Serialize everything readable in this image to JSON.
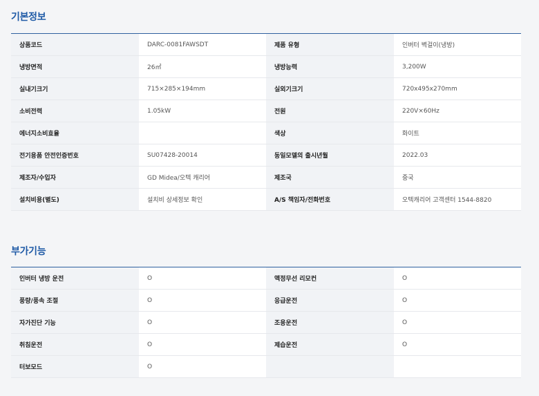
{
  "basic": {
    "title": "기본정보",
    "rows": [
      [
        {
          "k": "상품코드",
          "v": "DARC-0081FAWSDT"
        },
        {
          "k": "제품 유형",
          "v": "인버터 벽걸이(냉방)"
        }
      ],
      [
        {
          "k": "냉방면적",
          "v": "26㎡"
        },
        {
          "k": "냉방능력",
          "v": "3,200W"
        }
      ],
      [
        {
          "k": "실내기크기",
          "v": "715×285×194mm"
        },
        {
          "k": "실외기크기",
          "v": "720x495x270mm"
        }
      ],
      [
        {
          "k": "소비전력",
          "v": "1.05kW"
        },
        {
          "k": "전원",
          "v": "220V×60Hz"
        }
      ],
      [
        {
          "k": "에너지소비효율",
          "v": ""
        },
        {
          "k": "색상",
          "v": "화이트"
        }
      ],
      [
        {
          "k": "전기용품 안전인증번호",
          "v": "SU07428-20014"
        },
        {
          "k": "동일모델의 출시년월",
          "v": "2022.03"
        }
      ],
      [
        {
          "k": "제조자/수입자",
          "v": "GD Midea/오텍 캐리어"
        },
        {
          "k": "제조국",
          "v": "중국"
        }
      ],
      [
        {
          "k": "설치비용(별도)",
          "v": "설치비 상세정보 확인"
        },
        {
          "k": "A/S 책임자/전화번호",
          "v": "오텍캐리어 고객센터 1544-8820"
        }
      ]
    ]
  },
  "extra": {
    "title": "부가기능",
    "rows": [
      [
        {
          "k": "인버터 냉방 운전",
          "v": "O"
        },
        {
          "k": "액정무선 리모컨",
          "v": "O"
        }
      ],
      [
        {
          "k": "풍량/풍속 조절",
          "v": "O"
        },
        {
          "k": "응급운전",
          "v": "O"
        }
      ],
      [
        {
          "k": "자가진단 기능",
          "v": "O"
        },
        {
          "k": "조용운전",
          "v": "O"
        }
      ],
      [
        {
          "k": "취침운전",
          "v": "O"
        },
        {
          "k": "제습운전",
          "v": "O"
        }
      ],
      [
        {
          "k": "터보모드",
          "v": "O"
        },
        {
          "k": "",
          "v": ""
        }
      ]
    ]
  }
}
